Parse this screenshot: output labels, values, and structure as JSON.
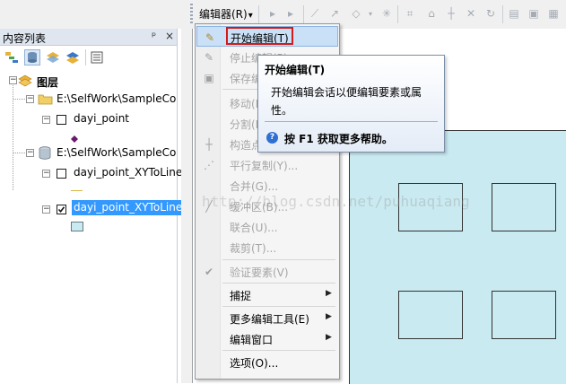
{
  "toolbar": {
    "editor_label": "编辑器(R)",
    "editor_arrow": "▾",
    "icons": [
      "grip",
      "select-arrow-icon",
      "edit-annotation-icon",
      "straight-segment-icon",
      "endpoint-arc-icon",
      "trace-icon",
      "point-icon",
      "edit-vertices-icon",
      "reshape-icon",
      "cut-polygons-icon",
      "split-icon",
      "rotate-icon",
      "delete-icon",
      "attributes-icon",
      "sketch-properties-icon",
      "create-features-icon"
    ]
  },
  "toc": {
    "title": "内容列表",
    "pin": "ᵖ",
    "close": "×",
    "layers_label": "图层",
    "tree": [
      {
        "kind": "folder",
        "label": "E:\\SelfWork\\SampleCo"
      },
      {
        "kind": "layer",
        "label": "dayi_point",
        "checked": false
      },
      {
        "kind": "database",
        "label": "E:\\SelfWork\\SampleCo"
      },
      {
        "kind": "layer",
        "label": "dayi_point_XYToLine",
        "checked": false
      },
      {
        "kind": "layer",
        "label": "dayi_point_XYToLine",
        "checked": true,
        "selected": true
      }
    ]
  },
  "menu": {
    "items": [
      {
        "label": "开始编辑(T)",
        "icon": "start-editing-icon",
        "disabled": false,
        "selected": true
      },
      {
        "label": "停止编辑(P)",
        "icon": "stop-editing-icon",
        "disabled": true
      },
      {
        "label": "保存编辑",
        "icon": "save-edits-icon",
        "disabled": true
      },
      {
        "label": "移动(M)...",
        "icon": "",
        "disabled": true
      },
      {
        "label": "分割(L)...",
        "icon": "",
        "disabled": true
      },
      {
        "label": "构造点...",
        "icon": "construct-points-icon",
        "disabled": true
      },
      {
        "label": "平行复制(Y)...",
        "icon": "copy-parallel-icon",
        "disabled": true
      },
      {
        "label": "合并(G)...",
        "icon": "",
        "disabled": true
      },
      {
        "label": "缓冲区(B)...",
        "icon": "buffer-icon",
        "disabled": true
      },
      {
        "label": "联合(U)...",
        "icon": "",
        "disabled": true
      },
      {
        "label": "裁剪(T)...",
        "icon": "",
        "disabled": true
      },
      {
        "label": "验证要素(V)",
        "icon": "validate-features-icon",
        "disabled": true
      },
      {
        "label": "捕捉",
        "icon": "",
        "disabled": false,
        "submenu": true
      },
      {
        "label": "更多编辑工具(E)",
        "icon": "",
        "disabled": false,
        "submenu": true
      },
      {
        "label": "编辑窗口",
        "icon": "",
        "disabled": false,
        "submenu": true
      },
      {
        "label": "选项(O)...",
        "icon": "",
        "disabled": false
      }
    ],
    "submenu_arrow": "▶"
  },
  "tooltip": {
    "title": "开始编辑(T)",
    "body": "开始编辑会话以便编辑要素或属性。",
    "help_icon_char": "?",
    "help": "按 F1 获取更多帮助。"
  },
  "watermark": "http://blog.csdn.net/puhuaqiang",
  "colors": {
    "map_extent": "#c9eaf1",
    "highlight_red": "#d11b1b",
    "selected_layer": "#3399ff",
    "menu_selected": "#c9e0f7"
  }
}
